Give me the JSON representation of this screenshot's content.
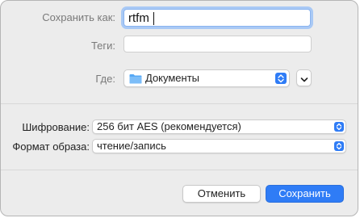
{
  "save_as": {
    "label": "Сохранить как:",
    "value": "rtfm"
  },
  "tags": {
    "label": "Теги:",
    "value": ""
  },
  "location": {
    "label": "Где:",
    "selected": "Документы",
    "folder_icon": "folder-icon",
    "expand_icon": "chevron-down-icon"
  },
  "encryption": {
    "label": "Шифрование:",
    "selected": "256 бит AES (рекомендуется)"
  },
  "image_format": {
    "label": "Формат образа:",
    "selected": "чтение/запись"
  },
  "buttons": {
    "cancel": "Отменить",
    "save": "Сохранить"
  },
  "colors": {
    "accent": "#2f7cf6",
    "folder": "#56a8f5",
    "background": "#ececec"
  }
}
